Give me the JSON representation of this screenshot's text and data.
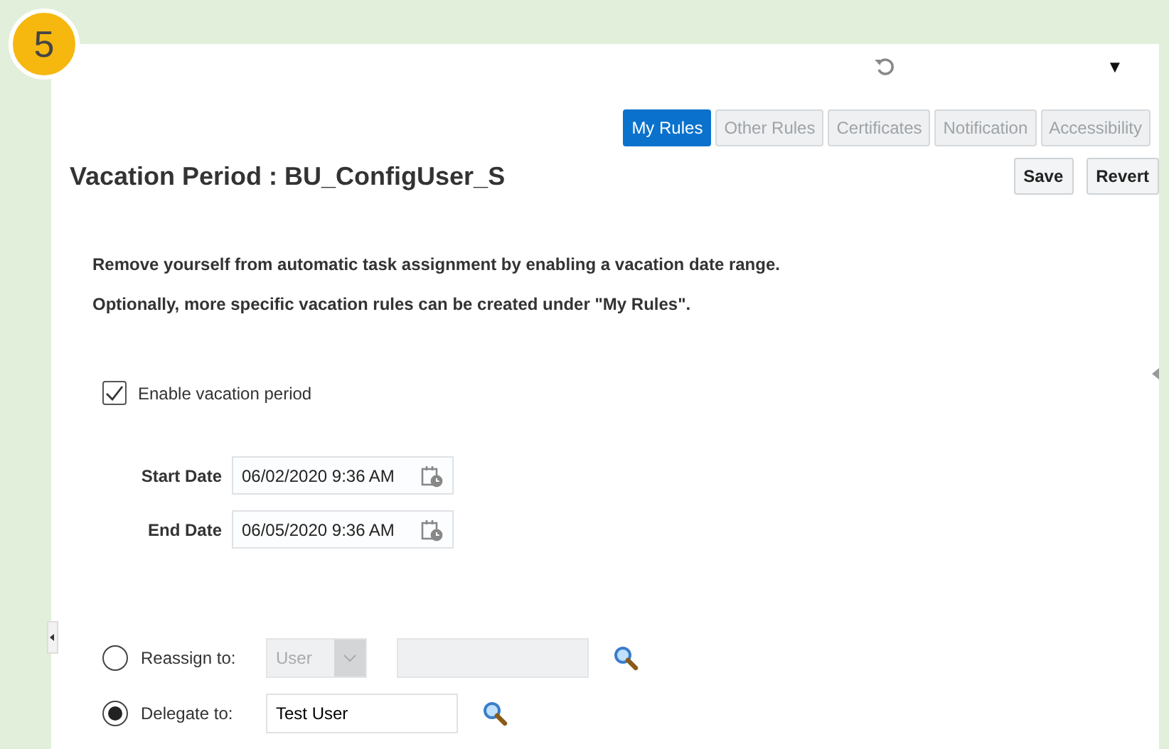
{
  "badge": "5",
  "header": {
    "menu_caret": "▼"
  },
  "tabs": [
    {
      "label": "My Rules",
      "selected": true,
      "disabled": false
    },
    {
      "label": "Other Rules",
      "selected": false,
      "disabled": true
    },
    {
      "label": "Certificates",
      "selected": false,
      "disabled": true
    },
    {
      "label": "Notification",
      "selected": false,
      "disabled": true
    },
    {
      "label": "Accessibility",
      "selected": false,
      "disabled": true
    }
  ],
  "title": "Vacation Period : BU_ConfigUser_S",
  "buttons": [
    "Save",
    "Revert"
  ],
  "description": [
    "Remove yourself from automatic task assignment by enabling a vacation date range.",
    "Optionally, more specific vacation rules can be created under \"My Rules\"."
  ],
  "enable_vacation": {
    "label": "Enable vacation period",
    "checked": true
  },
  "dates": [
    {
      "label": "Start Date",
      "value": "06/02/2020 9:36 AM"
    },
    {
      "label": "End Date",
      "value": "06/05/2020 9:36 AM"
    }
  ],
  "assignment": [
    {
      "label": "Reassign to:",
      "selected": false,
      "kind": "reassign",
      "type_value": "User",
      "disabled": true
    },
    {
      "label": "Delegate to:",
      "selected": true,
      "kind": "delegate",
      "disabled": false,
      "value": "Test User"
    }
  ]
}
